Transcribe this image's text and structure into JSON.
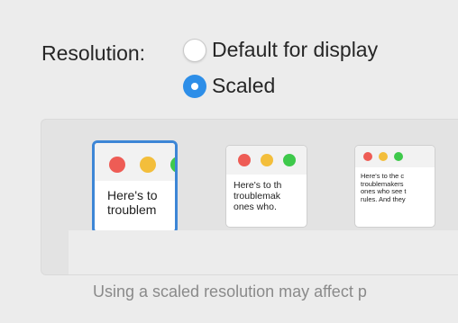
{
  "resolution": {
    "label": "Resolution:",
    "options": [
      {
        "label": "Default for display",
        "selected": false
      },
      {
        "label": "Scaled",
        "selected": true
      }
    ]
  },
  "thumbnails": [
    {
      "lines": [
        "Here's to",
        "troublem"
      ],
      "selected": true
    },
    {
      "lines": [
        "Here's to th",
        "troublemak",
        "ones who."
      ],
      "selected": false
    },
    {
      "lines": [
        "Here's to the c",
        "troublemakers",
        "ones who see t",
        "rules. And they"
      ],
      "selected": false
    }
  ],
  "note": "Using a scaled resolution may affect p",
  "colors": {
    "accent": "#2d8ee8",
    "selection_border": "#3d86d6"
  }
}
